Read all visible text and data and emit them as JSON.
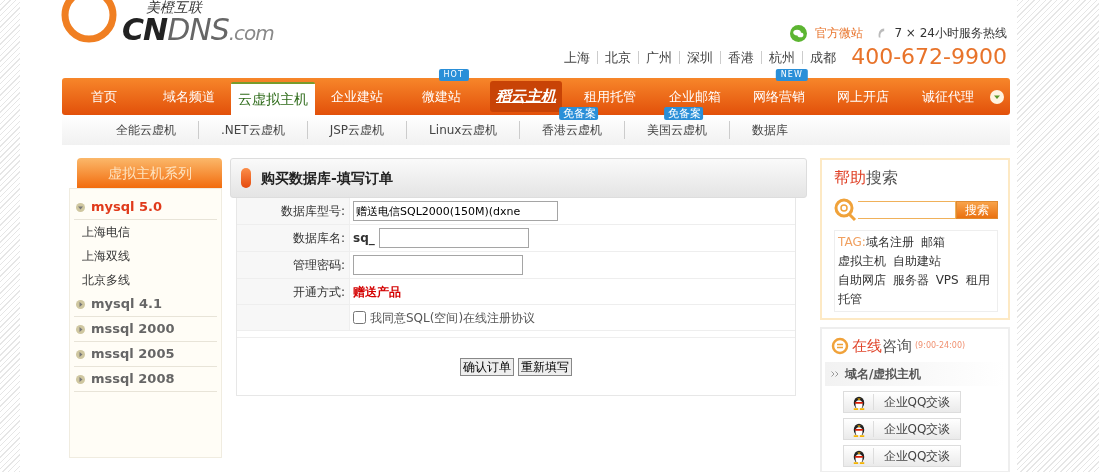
{
  "logo": {
    "tagline": "美橙互联",
    "brand_dark": "CN",
    "brand_light": "DNS",
    "domain": ".com"
  },
  "header": {
    "wechat_link": "官方微站",
    "hotline_label": "7 × 24小时服务热线",
    "cities": [
      "上海",
      "北京",
      "广州",
      "深圳",
      "香港",
      "杭州",
      "成都"
    ],
    "phone": "400-672-9900"
  },
  "nav": [
    {
      "kind": "link",
      "label": "首页",
      "selected": false
    },
    {
      "kind": "link",
      "label": "域名频道",
      "selected": false
    },
    {
      "kind": "link",
      "label": "云虚拟主机",
      "selected": true
    },
    {
      "kind": "link",
      "label": "企业建站",
      "selected": false
    },
    {
      "kind": "link",
      "label": "微建站",
      "selected": false,
      "badge": "HOT"
    },
    {
      "kind": "logo",
      "label": "稻云主机",
      "selected": false
    },
    {
      "kind": "link",
      "label": "租用托管",
      "selected": false
    },
    {
      "kind": "link",
      "label": "企业邮箱",
      "selected": false
    },
    {
      "kind": "link",
      "label": "网络营销",
      "selected": false,
      "badge": "NEW"
    },
    {
      "kind": "link",
      "label": "网上开店",
      "selected": false
    },
    {
      "kind": "link",
      "label": "诚征代理",
      "selected": false
    }
  ],
  "subnav": [
    {
      "label": "全能云虚机"
    },
    {
      "label": ".NET云虚机"
    },
    {
      "label": "JSP云虚机"
    },
    {
      "label": "Linux云虚机"
    },
    {
      "label": "香港云虚机",
      "badge": "免备案"
    },
    {
      "label": "美国云虚机",
      "badge": "免备案"
    },
    {
      "label": "数据库"
    }
  ],
  "sidebar": {
    "title": "虚拟主机系列",
    "groups": [
      {
        "label": "mysql 5.0",
        "expanded": true,
        "children": [
          {
            "label": "上海电信"
          },
          {
            "label": "上海双线"
          },
          {
            "label": "北京多线"
          }
        ]
      },
      {
        "label": "mysql 4.1",
        "expanded": false
      },
      {
        "label": "mssql 2000",
        "expanded": false
      },
      {
        "label": "mssql 2005",
        "expanded": false
      },
      {
        "label": "mssql 2008",
        "expanded": false
      }
    ]
  },
  "form": {
    "title": "购买数据库-填写订单",
    "rows": [
      {
        "kind": "input",
        "label": "数据库型号:",
        "value": "赠送电信SQL2000(150M)(dxne"
      },
      {
        "kind": "prefixed-input",
        "label": "数据库名:",
        "prefix": "sq_"
      },
      {
        "kind": "input",
        "label": "管理密码:"
      },
      {
        "kind": "text",
        "label": "开通方式:",
        "text": "赠送产品"
      },
      {
        "kind": "checkbox",
        "text": "我同意SQL(空间)在线注册协议",
        "checked": false
      }
    ],
    "buttons": [
      "确认订单",
      "重新填写"
    ]
  },
  "help": {
    "title_accent": "帮助",
    "title_rest": "搜索",
    "search_button": "搜索",
    "tag_label": "TAG:",
    "tags": [
      "域名注册",
      "邮箱",
      "虚拟主机",
      "自助建站",
      "自助网店",
      "服务器",
      "VPS",
      "租用",
      "托管"
    ]
  },
  "consult": {
    "title_accent": "在线",
    "title_rest": "咨询",
    "hours": "(9:00-24:00)",
    "group": "域名/虚拟主机",
    "buttons": [
      "企业QQ交谈",
      "企业QQ交谈",
      "企业QQ交谈"
    ]
  }
}
